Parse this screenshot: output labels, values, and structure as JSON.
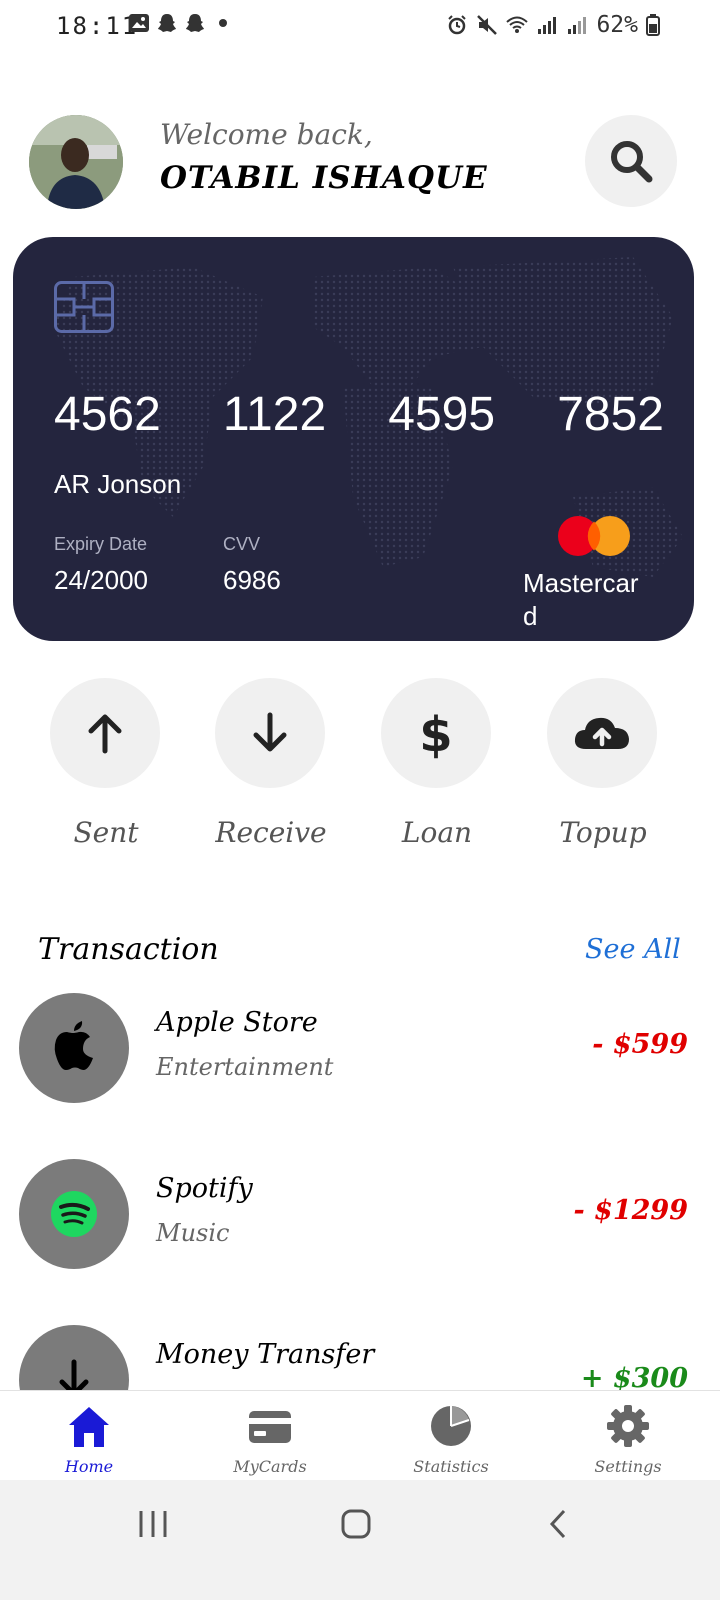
{
  "status_bar": {
    "time": "18:11",
    "battery": "62%"
  },
  "header": {
    "welcome": "Welcome back,",
    "username": "OTABIL ISHAQUE"
  },
  "card": {
    "number_groups": [
      "4562",
      "1122",
      "4595",
      "7852"
    ],
    "holder": "AR Jonson",
    "expiry_label": "Expiry Date",
    "expiry_value": "24/2000",
    "cvv_label": "CVV",
    "cvv_value": "6986",
    "brand": "Mastercard",
    "bg_color": "#24253e"
  },
  "actions": [
    {
      "label": "Sent",
      "icon": "arrow-up-icon"
    },
    {
      "label": "Receive",
      "icon": "arrow-down-icon"
    },
    {
      "label": "Loan",
      "icon": "dollar-icon"
    },
    {
      "label": "Topup",
      "icon": "cloud-upload-icon"
    }
  ],
  "transactions": {
    "title": "Transaction",
    "see_all": "See All",
    "items": [
      {
        "name": "Apple Store",
        "category": "Entertainment",
        "amount": "- $599",
        "color": "#e00000",
        "icon": "apple-icon"
      },
      {
        "name": "Spotify",
        "category": "Music",
        "amount": "- $1299",
        "color": "#e00000",
        "icon": "spotify-icon"
      },
      {
        "name": "Money Transfer",
        "category": "",
        "amount": "+ $300",
        "color": "#1a8a1a",
        "icon": "download-icon"
      }
    ]
  },
  "bottom_nav": [
    {
      "label": "Home",
      "icon": "home-icon",
      "active": true
    },
    {
      "label": "MyCards",
      "icon": "card-icon",
      "active": false
    },
    {
      "label": "Statistics",
      "icon": "pie-chart-icon",
      "active": false
    },
    {
      "label": "Settings",
      "icon": "gear-icon",
      "active": false
    }
  ],
  "colors": {
    "accent": "#1a1ad6",
    "link": "#1e6fd6",
    "debit": "#e00000",
    "credit": "#1a8a1a"
  }
}
